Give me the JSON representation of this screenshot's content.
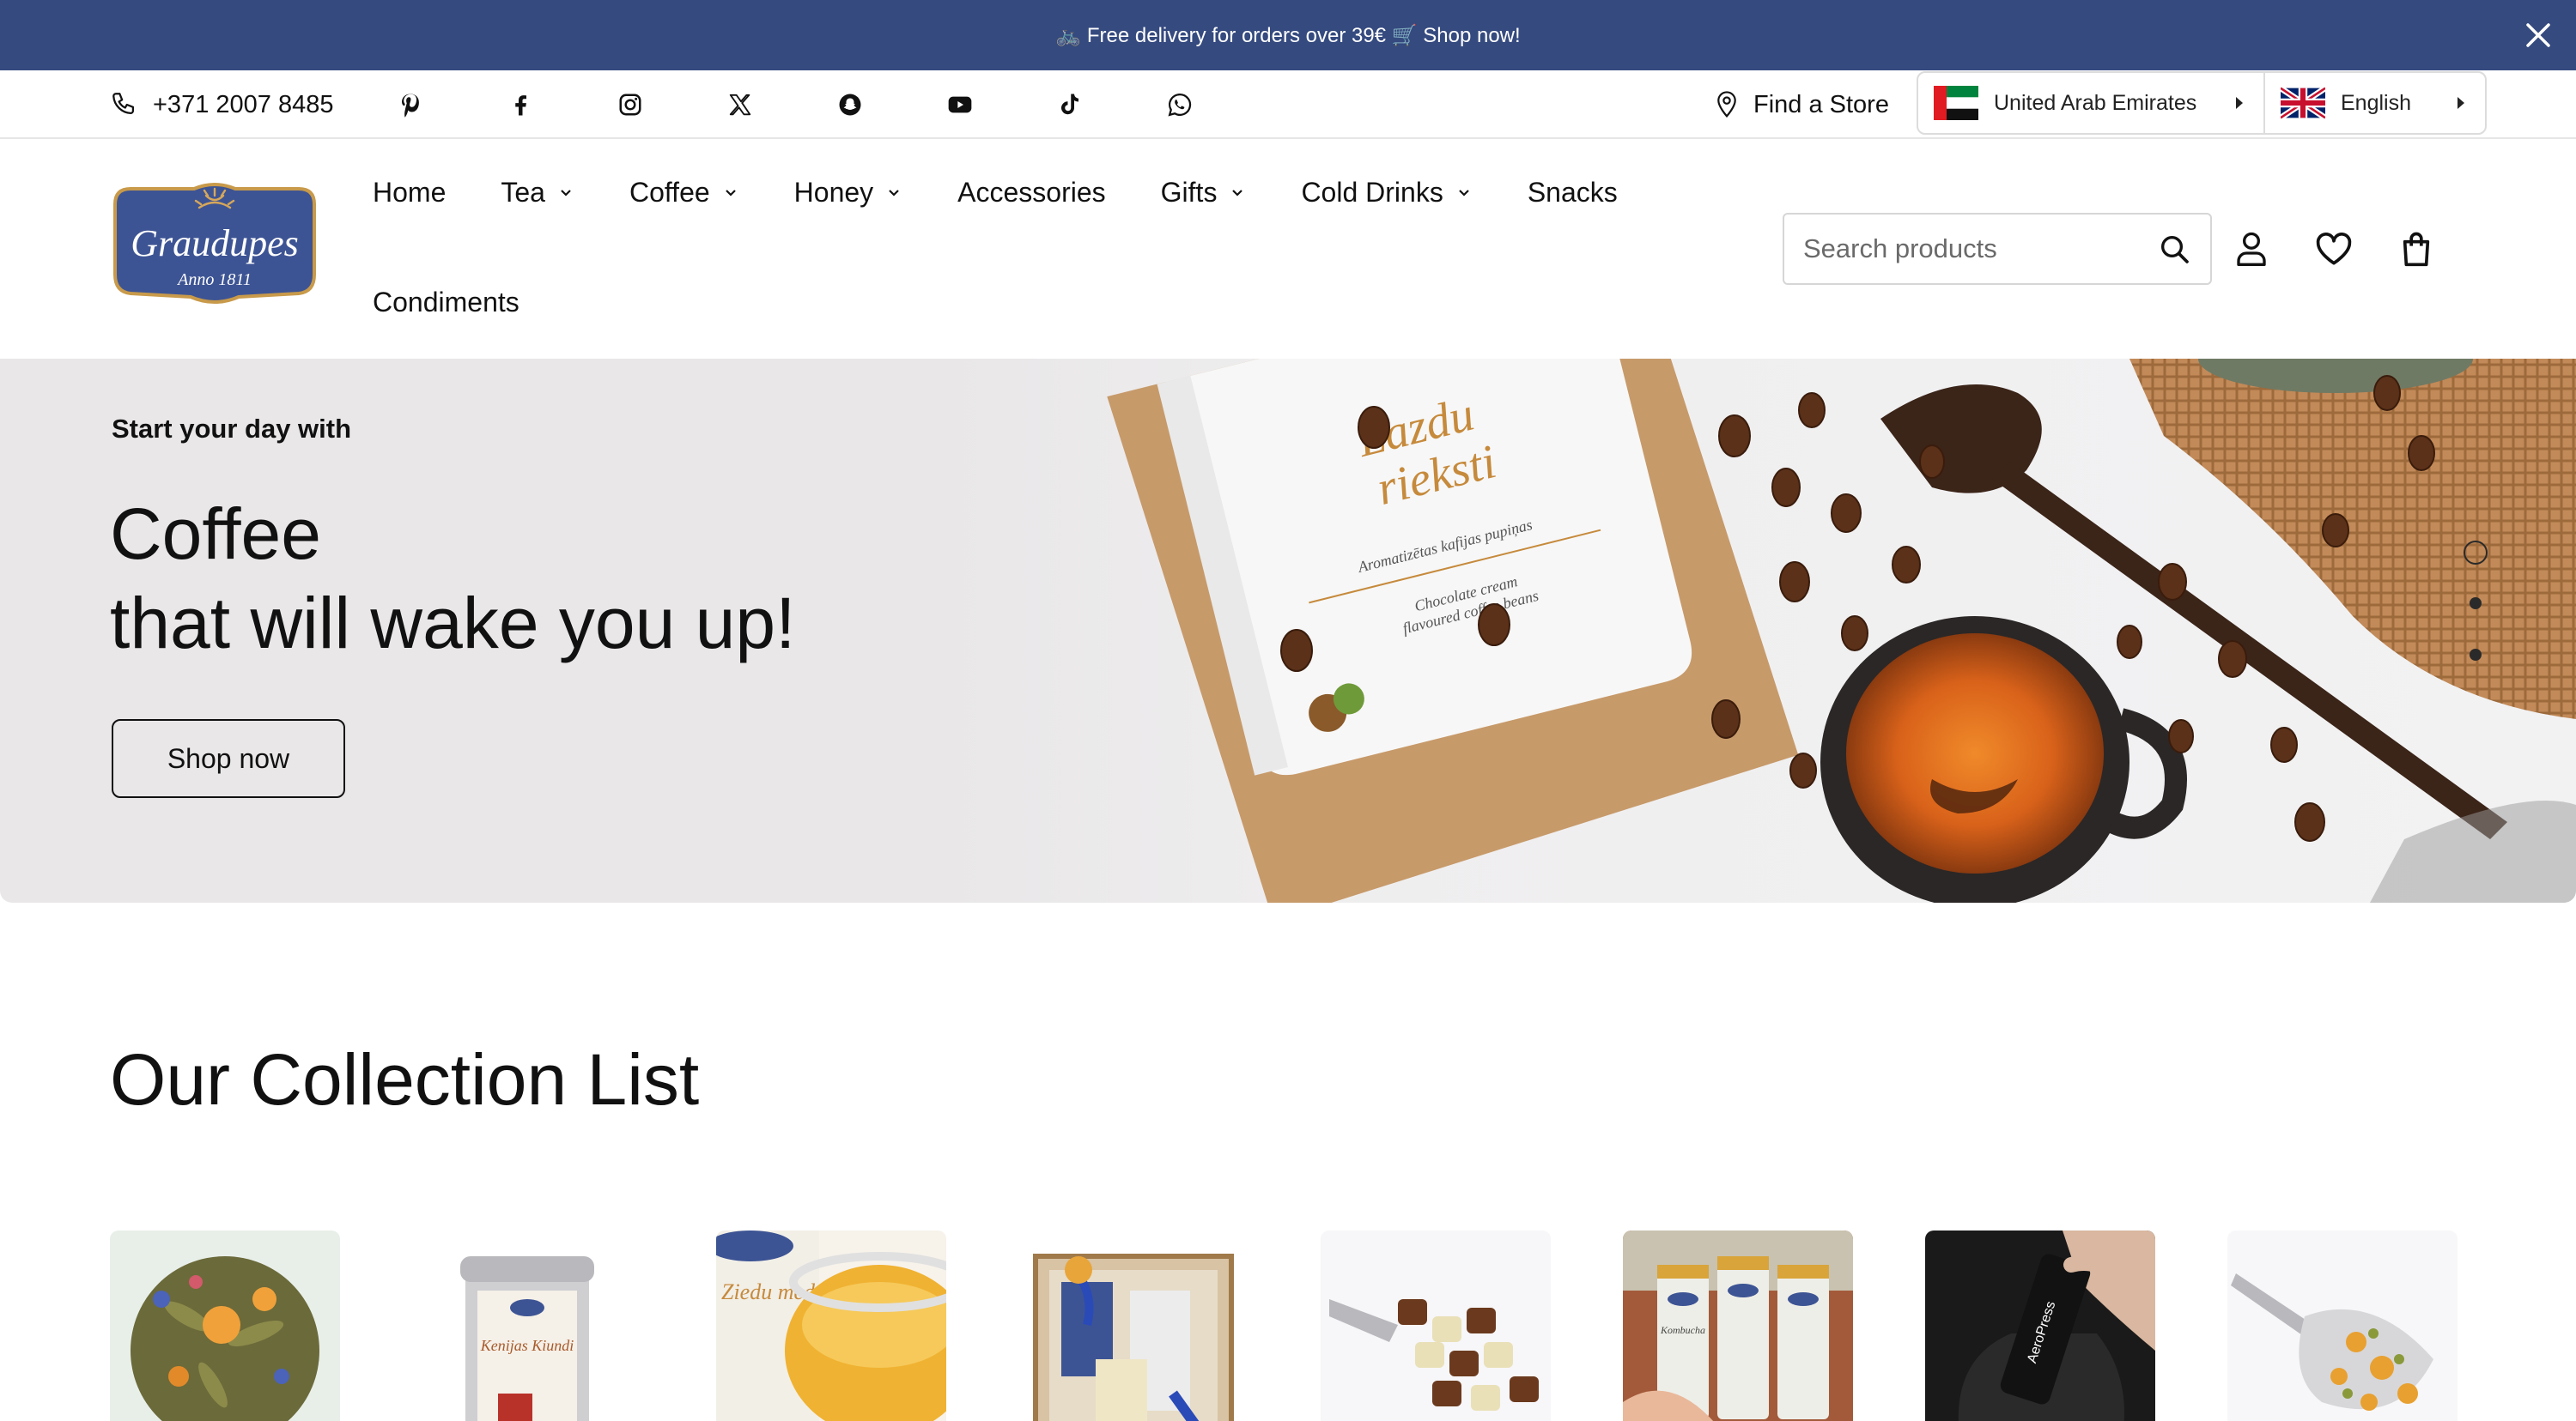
{
  "announcement": {
    "text": "🚲 Free delivery for orders over 39€ 🛒 Shop now!"
  },
  "utility": {
    "phone": "+371 2007 8485",
    "socials": [
      "pinterest-icon",
      "facebook-icon",
      "instagram-icon",
      "x-icon",
      "snapchat-icon",
      "youtube-icon",
      "tiktok-icon",
      "whatsapp-icon"
    ],
    "find_store": "Find a Store",
    "country": "United Arab Emirates",
    "language": "English"
  },
  "header": {
    "logo_text": "Graudupes",
    "logo_sub": "Anno 1811",
    "nav": [
      {
        "label": "Home",
        "dropdown": false
      },
      {
        "label": "Tea",
        "dropdown": true
      },
      {
        "label": "Coffee",
        "dropdown": true
      },
      {
        "label": "Honey",
        "dropdown": true
      },
      {
        "label": "Accessories",
        "dropdown": false
      },
      {
        "label": "Gifts",
        "dropdown": true
      },
      {
        "label": "Cold Drinks",
        "dropdown": true
      },
      {
        "label": "Snacks",
        "dropdown": false
      },
      {
        "label": "Condiments",
        "dropdown": false
      }
    ],
    "search_placeholder": "Search products"
  },
  "hero": {
    "eyebrow": "Start your day with",
    "headline_line1": "Coffee",
    "headline_line2": "that will wake you up!",
    "cta": "Shop now",
    "package_text1": "Lazdu",
    "package_text2": "rieksti",
    "package_sub1": "Aromatizētas kafijas pupiņas",
    "package_sub2": "Chocolate cream",
    "package_sub3": "flavoured coffee beans",
    "slides": 3,
    "active_slide": 1
  },
  "collection": {
    "title": "Our Collection List",
    "cards": [
      {
        "name": "tea-blend"
      },
      {
        "name": "tin",
        "label": "Kenijas Kiundi"
      },
      {
        "name": "honey",
        "label": "Ziedu medus"
      },
      {
        "name": "gift-box"
      },
      {
        "name": "candies"
      },
      {
        "name": "kombucha",
        "label": "Kombucha"
      },
      {
        "name": "aeropress",
        "label": "AeroPress"
      },
      {
        "name": "herbal-scoop"
      }
    ]
  }
}
